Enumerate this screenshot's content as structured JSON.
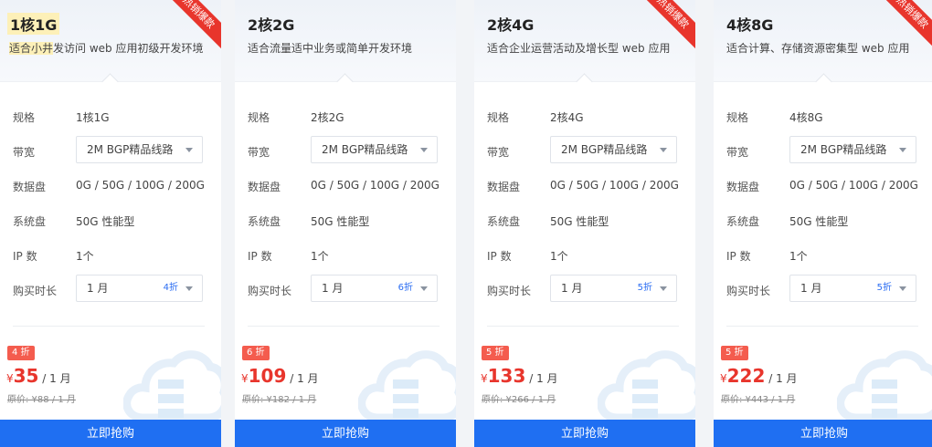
{
  "cards": [
    {
      "title": "1核1G",
      "desc_highlight": "适合小井",
      "desc": "发访问 web 应用初级开发环境",
      "ribbon": "热销爆款",
      "spec_label": "规格",
      "spec": "1核1G",
      "bandwidth_label": "带宽",
      "bandwidth": "2M BGP精品线路",
      "disk_label": "数据盘",
      "disk": "0G / 50G / 100G / 200G",
      "sysdisk_label": "系统盘",
      "sysdisk": "50G 性能型",
      "ip_label": "IP 数",
      "ip": "1个",
      "duration_label": "购买时长",
      "duration": "1 月",
      "duration_discount": "4折",
      "badge": "4 折",
      "currency": "¥",
      "price": "35",
      "unit": " / 1 月",
      "original": "原价: ¥88 / 1 月",
      "buy": "立即抢购"
    },
    {
      "title": "2核2G",
      "desc_highlight": "",
      "desc": "适合流量适中业务或简单开发环境",
      "ribbon": "",
      "spec_label": "规格",
      "spec": "2核2G",
      "bandwidth_label": "带宽",
      "bandwidth": "2M BGP精品线路",
      "disk_label": "数据盘",
      "disk": "0G / 50G / 100G / 200G",
      "sysdisk_label": "系统盘",
      "sysdisk": "50G 性能型",
      "ip_label": "IP 数",
      "ip": "1个",
      "duration_label": "购买时长",
      "duration": "1 月",
      "duration_discount": "6折",
      "badge": "6 折",
      "currency": "¥",
      "price": "109",
      "unit": " / 1 月",
      "original": "原价: ¥182 / 1 月",
      "buy": "立即抢购"
    },
    {
      "title": "2核4G",
      "desc_highlight": "",
      "desc": "适合企业运营活动及增长型 web 应用",
      "ribbon": "热销爆款",
      "spec_label": "规格",
      "spec": "2核4G",
      "bandwidth_label": "带宽",
      "bandwidth": "2M BGP精品线路",
      "disk_label": "数据盘",
      "disk": "0G / 50G / 100G / 200G",
      "sysdisk_label": "系统盘",
      "sysdisk": "50G 性能型",
      "ip_label": "IP 数",
      "ip": "1个",
      "duration_label": "购买时长",
      "duration": "1 月",
      "duration_discount": "5折",
      "badge": "5 折",
      "currency": "¥",
      "price": "133",
      "unit": " / 1 月",
      "original": "原价: ¥266 / 1 月",
      "buy": "立即抢购"
    },
    {
      "title": "4核8G",
      "desc_highlight": "",
      "desc": "适合计算、存储资源密集型 web 应用",
      "ribbon": "热销爆款",
      "spec_label": "规格",
      "spec": "4核8G",
      "bandwidth_label": "带宽",
      "bandwidth": "2M BGP精品线路",
      "disk_label": "数据盘",
      "disk": "0G / 50G / 100G / 200G",
      "sysdisk_label": "系统盘",
      "sysdisk": "50G 性能型",
      "ip_label": "IP 数",
      "ip": "1个",
      "duration_label": "购买时长",
      "duration": "1 月",
      "duration_discount": "5折",
      "badge": "5 折",
      "currency": "¥",
      "price": "222",
      "unit": " / 1 月",
      "original": "原价: ¥443 / 1 月",
      "buy": "立即抢购"
    }
  ],
  "colors": {
    "accent": "#1f6ff2",
    "price": "#e8352c",
    "badge": "#f45c4e",
    "ribbon": "#e8352c"
  },
  "icons": {
    "watermark": "cloud-icon",
    "dropdown": "chevron-down-icon"
  }
}
